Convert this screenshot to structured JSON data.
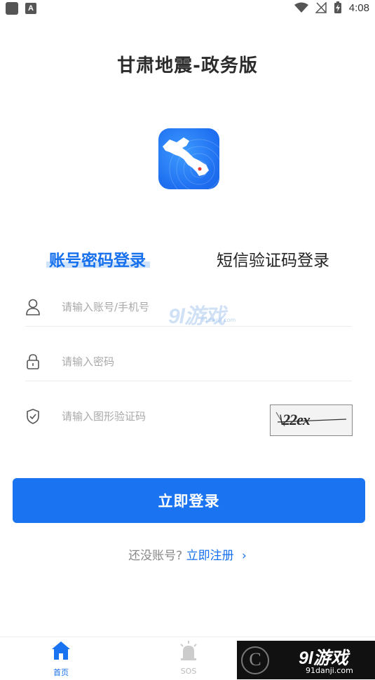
{
  "status_bar": {
    "time": "4:08",
    "left_icons": [
      "app-square-icon",
      "a-letter-icon"
    ],
    "left_a": "A",
    "right_icons": [
      "wifi-icon",
      "no-signal-icon",
      "battery-charging-icon"
    ]
  },
  "app": {
    "title": "甘肃地震-政务版"
  },
  "tabs": [
    {
      "label": "账号密码登录",
      "active": true
    },
    {
      "label": "短信验证码登录",
      "active": false
    }
  ],
  "form": {
    "account_placeholder": "请输入账号/手机号",
    "password_placeholder": "请输入密码",
    "captcha_placeholder": "请输入图形验证码",
    "captcha_text": "\\22ex"
  },
  "login_button": "立即登录",
  "register": {
    "question": "还没账号?",
    "link": "立即注册",
    "chevron": "›"
  },
  "bottom_nav": [
    {
      "label": "首页",
      "icon": "home-icon",
      "active": true
    },
    {
      "label": "SOS",
      "icon": "alarm-siren-icon",
      "active": false
    }
  ],
  "watermark": {
    "brand": "9l游戏",
    "domain": "91danji.com",
    "logo_letter": "C"
  },
  "colors": {
    "primary": "#1a73f0",
    "accent_text": "#1670ee",
    "highlight": "#cfe3fb"
  }
}
